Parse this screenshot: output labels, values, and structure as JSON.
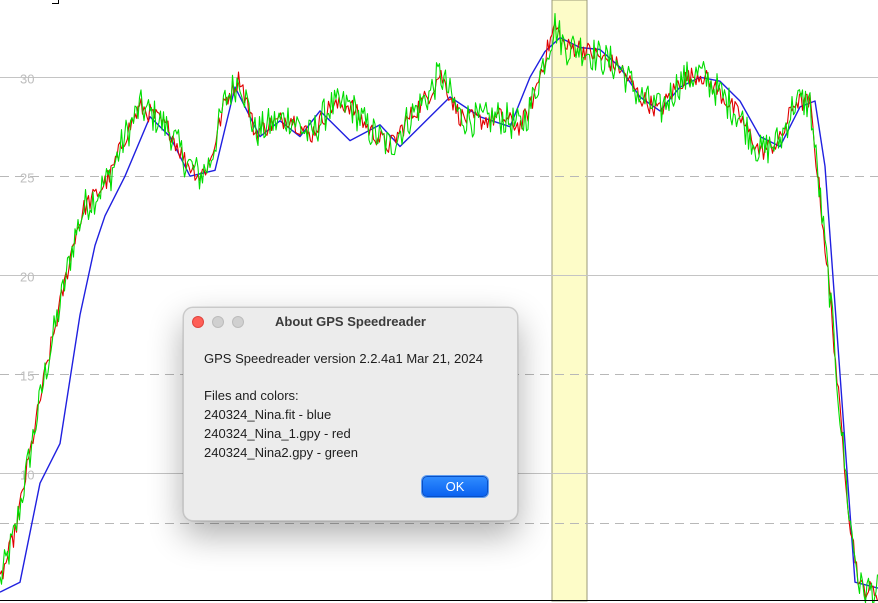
{
  "chart": {
    "y_ticks": [
      "30",
      "25",
      "20",
      "15",
      "10"
    ],
    "colors": {
      "blue": "#2020e0",
      "red": "#e00000",
      "green": "#00dd00",
      "highlight": "#fdfcc8"
    }
  },
  "chart_data": {
    "type": "line",
    "ylim": [
      3.6,
      33.9
    ],
    "xlim": [
      0,
      878
    ],
    "series": [
      {
        "color": "blue",
        "x": [
          0,
          20,
          40,
          60,
          80,
          95,
          105,
          125,
          150,
          170,
          190,
          215,
          235,
          260,
          280,
          300,
          320,
          350,
          380,
          400,
          430,
          450,
          480,
          510,
          530,
          545,
          560,
          580,
          600,
          620,
          640,
          660,
          680,
          700,
          720,
          740,
          760,
          780,
          800,
          815,
          825,
          840,
          855,
          878
        ],
        "y": [
          4.0,
          4.5,
          9.5,
          11.5,
          18.0,
          21.5,
          23.0,
          25.0,
          28.0,
          27.0,
          25.0,
          25.3,
          29.5,
          27.0,
          27.8,
          27.0,
          28.3,
          26.8,
          27.6,
          26.5,
          28.0,
          29.0,
          28.0,
          27.5,
          30.0,
          31.3,
          32.0,
          31.5,
          31.4,
          30.5,
          29.0,
          28.3,
          29.5,
          30.0,
          29.8,
          28.8,
          27.0,
          26.5,
          28.5,
          28.8,
          25.5,
          15.0,
          4.5,
          4.2
        ]
      },
      {
        "color": "green",
        "x": [
          0,
          15,
          30,
          45,
          60,
          75,
          85,
          95,
          110,
          125,
          140,
          155,
          170,
          185,
          200,
          210,
          225,
          240,
          255,
          270,
          290,
          310,
          330,
          350,
          370,
          390,
          410,
          430,
          440,
          460,
          480,
          500,
          520,
          530,
          545,
          555,
          565,
          580,
          600,
          620,
          640,
          660,
          680,
          700,
          720,
          740,
          760,
          780,
          795,
          810,
          820,
          830,
          840,
          850,
          860,
          878
        ],
        "y": [
          4.5,
          7.0,
          11.0,
          15.0,
          18.5,
          22.0,
          23.5,
          24.0,
          25.0,
          27.0,
          28.5,
          28.0,
          27.3,
          25.8,
          25.0,
          25.7,
          28.8,
          30.0,
          27.2,
          27.6,
          28.0,
          27.0,
          28.5,
          28.6,
          27.3,
          26.5,
          28.0,
          29.2,
          30.2,
          28.0,
          27.8,
          28.0,
          27.5,
          28.4,
          31.0,
          32.6,
          31.5,
          31.5,
          31.0,
          30.5,
          29.0,
          28.3,
          29.8,
          30.2,
          29.2,
          28.0,
          26.2,
          26.8,
          28.8,
          28.7,
          24.0,
          19.0,
          13.0,
          7.5,
          4.2,
          4.0
        ]
      },
      {
        "color": "red",
        "x": [
          0,
          15,
          30,
          45,
          60,
          75,
          85,
          95,
          110,
          125,
          140,
          155,
          170,
          185,
          200,
          210,
          225,
          240,
          255,
          270,
          290,
          310,
          330,
          350,
          370,
          390,
          410,
          430,
          440,
          460,
          480,
          500,
          520,
          530,
          545,
          555,
          565,
          580,
          600,
          620,
          640,
          660,
          680,
          700,
          720,
          740,
          760,
          780,
          795,
          810,
          820,
          830,
          840,
          850,
          860,
          878
        ],
        "y": [
          4.5,
          7.0,
          11.0,
          15.0,
          18.5,
          22.0,
          23.5,
          24.0,
          25.0,
          27.0,
          28.5,
          28.0,
          27.3,
          25.8,
          25.0,
          25.7,
          28.8,
          30.0,
          27.2,
          27.6,
          28.0,
          27.0,
          28.5,
          28.6,
          27.3,
          26.5,
          28.0,
          29.2,
          30.2,
          28.0,
          27.8,
          28.0,
          27.5,
          28.4,
          31.0,
          32.6,
          31.5,
          31.5,
          31.0,
          30.5,
          29.0,
          28.3,
          29.8,
          30.2,
          29.2,
          28.0,
          26.2,
          26.8,
          28.8,
          28.7,
          24.0,
          19.0,
          13.0,
          7.5,
          4.2,
          4.0
        ]
      }
    ]
  },
  "dialog": {
    "title": "About GPS Speedreader",
    "version_line": "GPS Speedreader version 2.2.4a1 Mar 21, 2024",
    "files_heading": "Files and colors:",
    "files": [
      "240324_Nina.fit - blue",
      "240324_Nina_1.gpy - red",
      "240324_Nina2.gpy - green"
    ],
    "ok_label": "OK"
  }
}
